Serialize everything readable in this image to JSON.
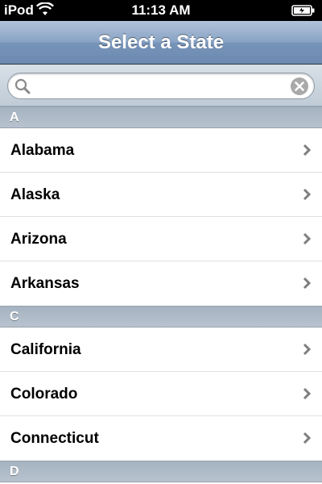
{
  "status_bar": {
    "carrier": "iPod",
    "time": "11:13 AM",
    "wifi_icon": "wifi-icon",
    "battery_icon": "battery-icon"
  },
  "nav": {
    "title": "Select a State"
  },
  "search": {
    "value": "",
    "placeholder": "",
    "search_icon": "magnifier-icon",
    "clear_icon": "clear-icon"
  },
  "sections": [
    {
      "header": "A",
      "rows": [
        "Alabama",
        "Alaska",
        "Arizona",
        "Arkansas"
      ]
    },
    {
      "header": "C",
      "rows": [
        "California",
        "Colorado",
        "Connecticut"
      ]
    },
    {
      "header": "D",
      "rows": []
    }
  ],
  "colors": {
    "nav_bar": "#7a96bb",
    "section_header": "#aeb9c5",
    "chevron": "#7f7f7f"
  }
}
